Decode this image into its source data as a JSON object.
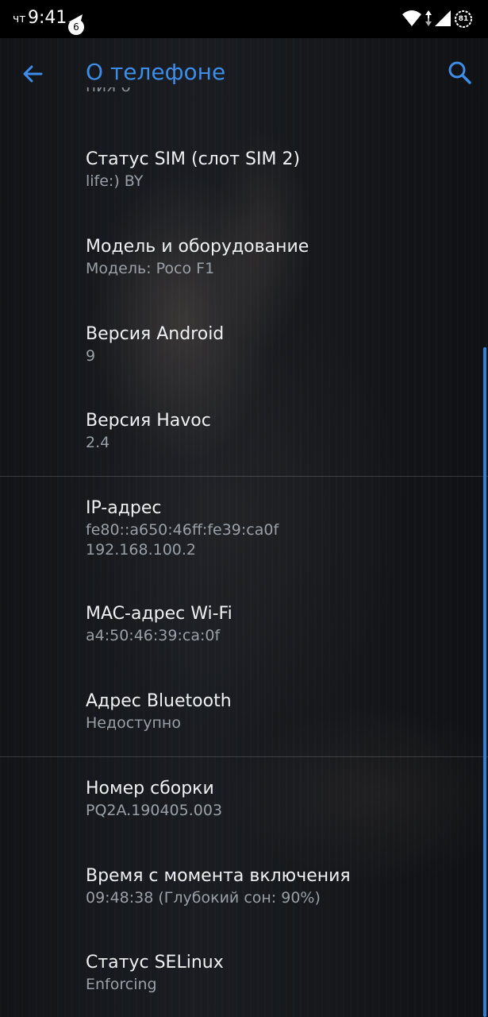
{
  "status_bar": {
    "day": "чт",
    "time": "9:41",
    "notification_count": "6",
    "battery_level": "81"
  },
  "header": {
    "title": "О телефоне"
  },
  "colors": {
    "accent": "#3d8de8",
    "background": "#121418"
  },
  "cut_off_item": {
    "text": "ния о"
  },
  "items": [
    {
      "title": "Статус SIM (слот SIM 2)",
      "subtitle": "life:) BY"
    },
    {
      "title": "Модель и оборудование",
      "subtitle": "Модель: Poco F1"
    },
    {
      "title": "Версия Android",
      "subtitle": "9"
    },
    {
      "title": "Версия Havoc",
      "subtitle": "2.4"
    },
    {
      "title": "IP-адрес",
      "subtitle": "fe80::a650:46ff:fe39:ca0f",
      "subtitle2": "192.168.100.2"
    },
    {
      "title": "MAC-адрес Wi-Fi",
      "subtitle": "a4:50:46:39:ca:0f"
    },
    {
      "title": "Адрес Bluetooth",
      "subtitle": "Недоступно"
    },
    {
      "title": "Номер сборки",
      "subtitle": "PQ2A.190405.003"
    },
    {
      "title": "Время с момента включения",
      "subtitle": "09:48:38 (Глубокий сон: 90%)"
    },
    {
      "title": "Статус SELinux",
      "subtitle": "Enforcing"
    }
  ]
}
